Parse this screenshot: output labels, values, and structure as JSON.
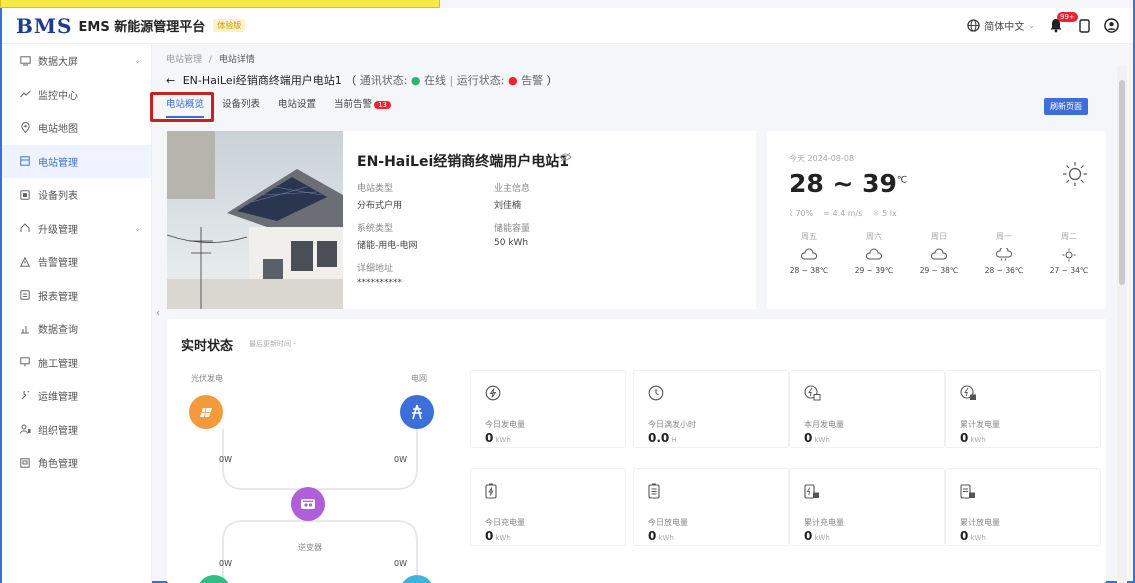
{
  "header": {
    "logo": "BMS",
    "app_name": "EMS 新能源管理平台",
    "badge": "体验版",
    "language": "简体中文",
    "notif_count": "99+"
  },
  "sidebar": {
    "items": [
      {
        "label": "数据大屏",
        "icon": "monitor-icon"
      },
      {
        "label": "监控中心",
        "icon": "trend-icon"
      },
      {
        "label": "电站地图",
        "icon": "location-icon"
      },
      {
        "label": "电站管理",
        "icon": "station-icon"
      },
      {
        "label": "设备列表",
        "icon": "device-icon"
      },
      {
        "label": "升级管理",
        "icon": "upgrade-icon"
      },
      {
        "label": "告警管理",
        "icon": "alarm-icon"
      },
      {
        "label": "报表管理",
        "icon": "report-icon"
      },
      {
        "label": "数据查询",
        "icon": "query-icon"
      },
      {
        "label": "施工管理",
        "icon": "construction-icon"
      },
      {
        "label": "运维管理",
        "icon": "maintenance-icon"
      },
      {
        "label": "组织管理",
        "icon": "org-icon"
      },
      {
        "label": "角色管理",
        "icon": "role-icon"
      }
    ]
  },
  "breadcrumb": {
    "root": "电站管理",
    "sep": "/",
    "current": "电站详情"
  },
  "title": {
    "back": "←",
    "station": "EN-HaiLei经销商终端用户电站1",
    "paren_open": "（",
    "comm_label": "通讯状态:",
    "comm_value": "在线",
    "divider": "|",
    "run_label": "运行状态:",
    "run_value": "告警",
    "paren_close": "）"
  },
  "tabs": [
    {
      "label": "电站概览"
    },
    {
      "label": "设备列表"
    },
    {
      "label": "电站设置"
    },
    {
      "label": "当前告警",
      "badge": "13"
    }
  ],
  "refresh_label": "刷新页面",
  "station": {
    "name": "EN-HaiLei经销商终端用户电站1",
    "type_label": "电站类型",
    "type_value": "分布式户用",
    "owner_label": "业主信息",
    "owner_value": "刘佳楠",
    "sys_label": "系统类型",
    "sys_value": "储能-用电-电网",
    "cap_label": "储能容量",
    "cap_value": "50 kWh",
    "addr_label": "详细地址",
    "addr_value": "**********"
  },
  "weather": {
    "date": "今天 2024-08-08",
    "temp": "28 ~ 39",
    "unit": "℃",
    "humidity": "70%",
    "wind": "4.4 m/s",
    "light": "5 lx",
    "forecast": [
      {
        "day": "周五",
        "range": "28 ~ 38℃"
      },
      {
        "day": "周六",
        "range": "29 ~ 39℃"
      },
      {
        "day": "周日",
        "range": "29 ~ 38℃"
      },
      {
        "day": "周一",
        "range": "28 ~ 36℃"
      },
      {
        "day": "周二",
        "range": "27 ~ 34℃"
      }
    ]
  },
  "realtime": {
    "title": "实时状态",
    "subtitle": "最后更新时间 -",
    "pv_label": "光伏发电",
    "grid_label": "电网",
    "inverter_label": "逆变器",
    "pv_value": "0W",
    "grid_value": "0W",
    "bottom_left": "0W",
    "bottom_right": "0W",
    "stats": [
      {
        "label": "今日发电量",
        "value": "0",
        "unit": "kWh"
      },
      {
        "label": "今日满发小时",
        "value": "0.0",
        "unit": "H"
      },
      {
        "label": "本月发电量",
        "value": "0",
        "unit": "kWh"
      },
      {
        "label": "累计发电量",
        "value": "0",
        "unit": "kWh"
      },
      {
        "label": "今日充电量",
        "value": "0",
        "unit": "kWh"
      },
      {
        "label": "今日放电量",
        "value": "0",
        "unit": "kWh"
      },
      {
        "label": "累计充电量",
        "value": "0",
        "unit": "kWh"
      },
      {
        "label": "累计放电量",
        "value": "0",
        "unit": "kWh"
      }
    ]
  },
  "colors": {
    "accent": "#3e6fd8",
    "pv": "#f59a3c",
    "grid": "#3d6fd9",
    "inverter": "#b05fd8",
    "alert": "#f5222d",
    "online": "#2bb673"
  }
}
